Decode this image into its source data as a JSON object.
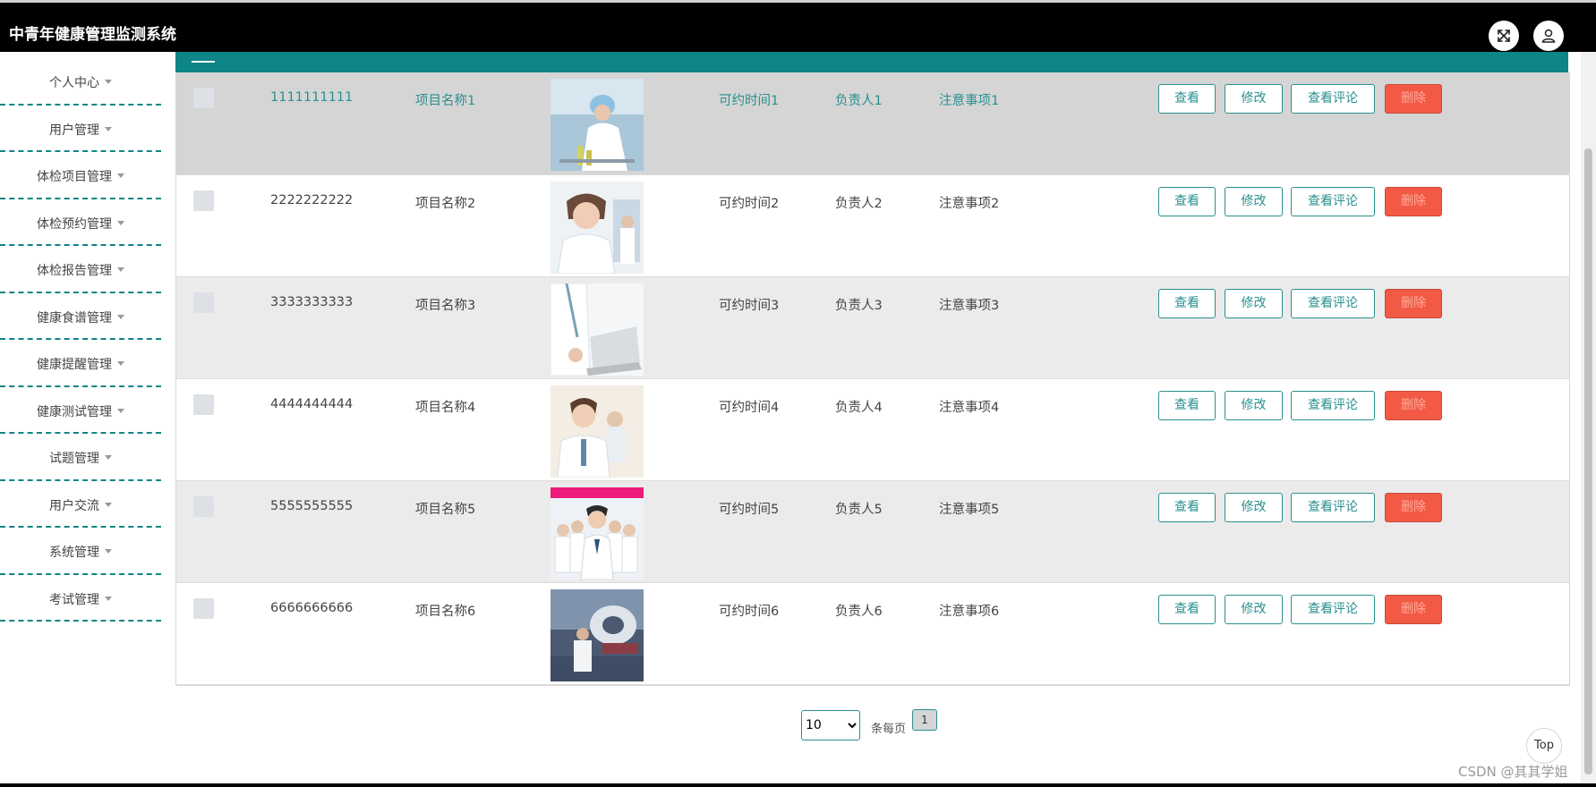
{
  "app": {
    "title": "中青年健康管理监测系统"
  },
  "header_icons": {
    "fullscreen": "expand-arrows-icon",
    "user": "user-icon"
  },
  "sidebar": {
    "items": [
      {
        "label": "个人中心"
      },
      {
        "label": "用户管理"
      },
      {
        "label": "体检项目管理"
      },
      {
        "label": "体检预约管理"
      },
      {
        "label": "体检报告管理"
      },
      {
        "label": "健康食谱管理"
      },
      {
        "label": "健康提醒管理"
      },
      {
        "label": "健康测试管理"
      },
      {
        "label": "试题管理"
      },
      {
        "label": "用户交流"
      },
      {
        "label": "系统管理"
      },
      {
        "label": "考试管理"
      }
    ]
  },
  "actions": {
    "view": "查看",
    "edit": "修改",
    "comments": "查看评论",
    "delete": "删除"
  },
  "rows": [
    {
      "id": "1111111111",
      "name": "项目名称1",
      "time": "可约时间1",
      "owner": "负责人1",
      "note": "注意事项1",
      "image": "doctor-with-microscope"
    },
    {
      "id": "2222222222",
      "name": "项目名称2",
      "time": "可约时间2",
      "owner": "负责人2",
      "note": "注意事项2",
      "image": "female-doctor-portrait"
    },
    {
      "id": "3333333333",
      "name": "项目名称3",
      "time": "可约时间3",
      "owner": "负责人3",
      "note": "注意事项3",
      "image": "doctor-with-laptop"
    },
    {
      "id": "4444444444",
      "name": "项目名称4",
      "time": "可约时间4",
      "owner": "负责人4",
      "note": "注意事项4",
      "image": "smiling-doctor-team"
    },
    {
      "id": "5555555555",
      "name": "项目名称5",
      "time": "可约时间5",
      "owner": "负责人5",
      "note": "注意事项5",
      "image": "medical-team-group"
    },
    {
      "id": "6666666666",
      "name": "项目名称6",
      "time": "可约时间6",
      "owner": "负责人6",
      "note": "注意事项6",
      "image": "hospital-scanner-room"
    }
  ],
  "pagination": {
    "page_size": "10",
    "per_page_label": "条每页",
    "current_page": "1"
  },
  "top_button": "Top",
  "watermark": "CSDN @其其学姐",
  "colors": {
    "accent": "#0e8586",
    "danger": "#f35a45",
    "header": "#000000"
  }
}
